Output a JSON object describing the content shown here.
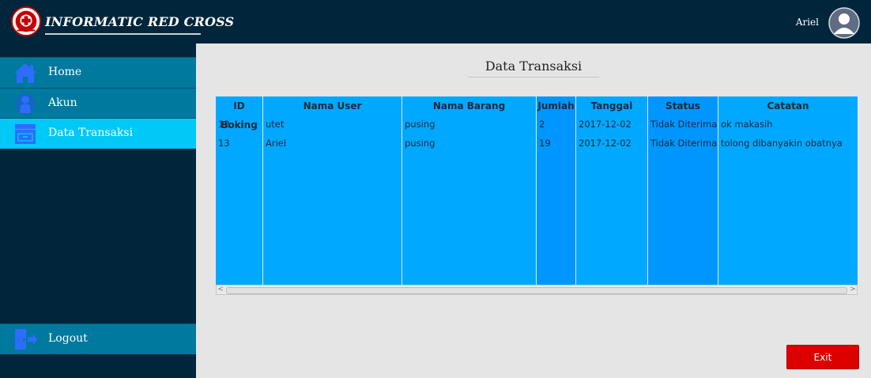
{
  "app": {
    "title": "INFORMATIC RED CROSS"
  },
  "user": {
    "name": "Ariel"
  },
  "sidebar": {
    "items": [
      {
        "label": "Home"
      },
      {
        "label": "Akun"
      },
      {
        "label": "Data Transaksi"
      }
    ],
    "logout_label": "Logout"
  },
  "main": {
    "title": "Data Transaksi",
    "exit_label": "Exit"
  },
  "table": {
    "columns": [
      "ID Boking",
      "Nama User",
      "Nama Barang",
      "Jumlah",
      "Tanggal",
      "Status",
      "Catatan"
    ],
    "rows": [
      [
        "12",
        "utet",
        "pusing",
        "2",
        "2017-12-02",
        "Tidak Diterima",
        "ok makasih"
      ],
      [
        "13",
        "Ariel",
        "pusing",
        "19",
        "2017-12-02",
        "Tidak Diterima",
        "tolong dibanyakin obatnya"
      ]
    ]
  },
  "colors": {
    "header_bg": "#01263c",
    "nav_item": "#00799e",
    "nav_active": "#00c8f7",
    "table_bg": "#00a8ff",
    "table_col_dark": "#0096ff",
    "exit_button": "#dd0000"
  }
}
